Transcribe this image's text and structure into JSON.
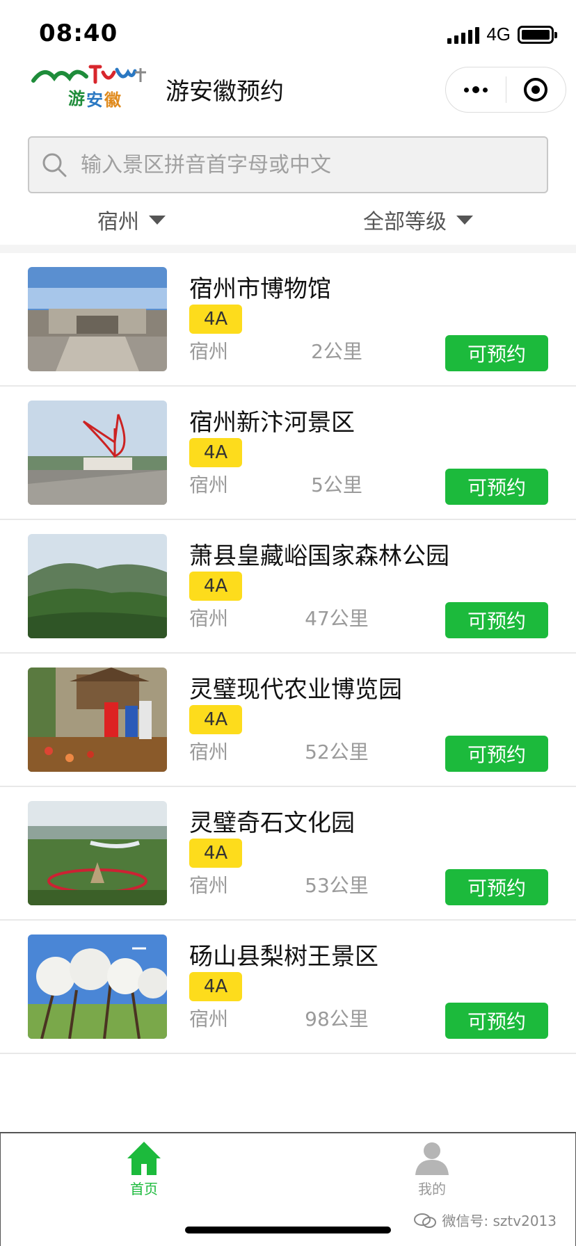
{
  "status_bar": {
    "time": "08:40",
    "network": "4G"
  },
  "nav": {
    "title": "游安徽预约"
  },
  "search": {
    "placeholder": "输入景区拼音首字母或中文"
  },
  "filters": {
    "city": "宿州",
    "level": "全部等级"
  },
  "items": [
    {
      "name": "宿州市博物馆",
      "level": "4A",
      "city": "宿州",
      "distance": "2公里",
      "action": "可预约"
    },
    {
      "name": "宿州新汴河景区",
      "level": "4A",
      "city": "宿州",
      "distance": "5公里",
      "action": "可预约"
    },
    {
      "name": "萧县皇藏峪国家森林公园",
      "level": "4A",
      "city": "宿州",
      "distance": "47公里",
      "action": "可预约"
    },
    {
      "name": "灵璧现代农业博览园",
      "level": "4A",
      "city": "宿州",
      "distance": "52公里",
      "action": "可预约"
    },
    {
      "name": "灵璧奇石文化园",
      "level": "4A",
      "city": "宿州",
      "distance": "53公里",
      "action": "可预约"
    },
    {
      "name": "砀山县梨树王景区",
      "level": "4A",
      "city": "宿州",
      "distance": "98公里",
      "action": "可预约"
    }
  ],
  "tab_bar": {
    "home": "首页",
    "mine": "我的"
  },
  "watermark": "微信号: sztv2013",
  "colors": {
    "accent_green": "#1cba3c",
    "badge_yellow": "#fddc1c"
  },
  "icons": [
    "search-icon",
    "caret-down-icon",
    "more-dots-icon",
    "target-icon",
    "home-icon",
    "user-icon",
    "wechat-icon"
  ]
}
